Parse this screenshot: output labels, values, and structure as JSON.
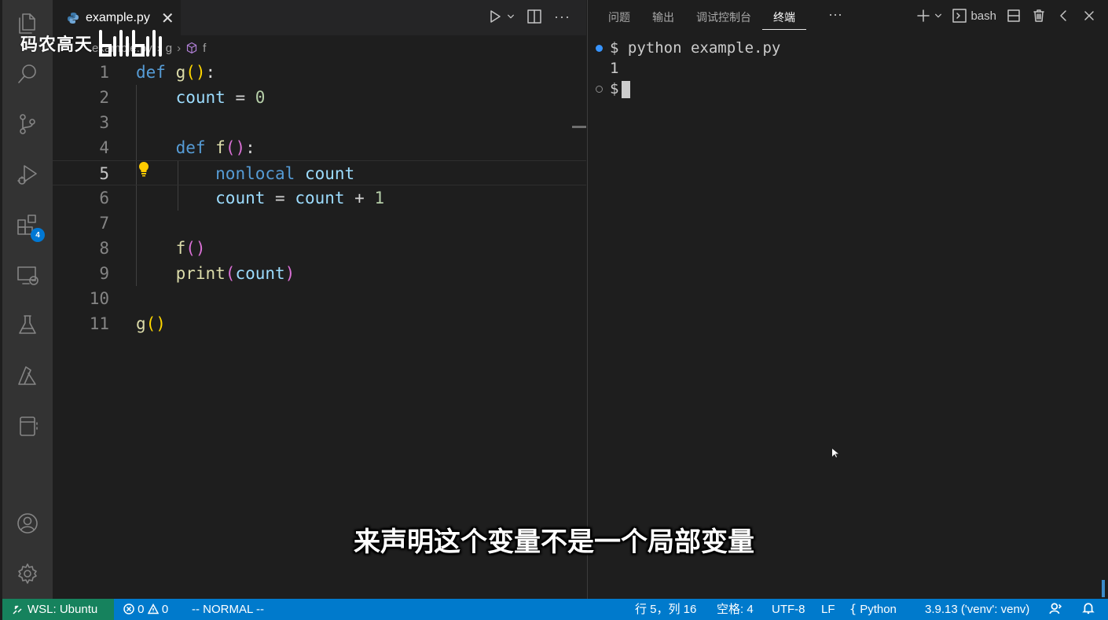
{
  "editor": {
    "tab_label": "example.py",
    "breadcrumb": [
      "example.py",
      "g",
      "f"
    ],
    "lines": [
      {
        "n": "1"
      },
      {
        "n": "2"
      },
      {
        "n": "3"
      },
      {
        "n": "4"
      },
      {
        "n": "5"
      },
      {
        "n": "6"
      },
      {
        "n": "7"
      },
      {
        "n": "8"
      },
      {
        "n": "9"
      },
      {
        "n": "10"
      },
      {
        "n": "11"
      }
    ],
    "code": {
      "l1_kw": "def",
      "l1_fn": "g",
      "l1_rest": ":",
      "l2_var": "count",
      "l2_op": " = ",
      "l2_num": "0",
      "l4_kw": "def",
      "l4_fn": "f",
      "l4_rest": ":",
      "l5_kw": "nonlocal",
      "l5_var": "count",
      "l6_var1": "count",
      "l6_op1": " = ",
      "l6_var2": "count",
      "l6_op2": " + ",
      "l6_num": "1",
      "l8_fn": "f",
      "l9_fn": "print",
      "l9_var": "count",
      "l11_fn": "g"
    }
  },
  "panel": {
    "tabs": [
      "问题",
      "输出",
      "调试控制台",
      "终端"
    ],
    "active_tab": "终端",
    "more": "···",
    "shell": "bash",
    "terminal": {
      "prompt": "$",
      "command": "python example.py",
      "output": "1"
    }
  },
  "watermark": {
    "text": "码农高天",
    "logo_text": "bilibili"
  },
  "subtitle": "来声明这个变量不是一个局部变量",
  "activity_badge": "4",
  "statusbar": {
    "remote": "WSL: Ubuntu",
    "errors": "0",
    "warnings": "0",
    "mode": "-- NORMAL --",
    "position": "行 5，列 16",
    "spaces": "空格: 4",
    "encoding": "UTF-8",
    "eol": "LF",
    "language": "Python",
    "interpreter": "3.9.13 ('venv': venv)"
  },
  "colors": {
    "statusbar": "#007acc",
    "remote": "#16825d",
    "keyword": "#569cd6",
    "function": "#dcdcaa",
    "variable": "#9cdcfe",
    "number": "#b5cea8",
    "bracket": "#ffd700"
  }
}
